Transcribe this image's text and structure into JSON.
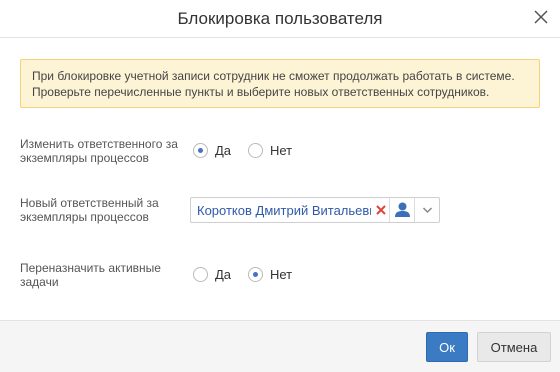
{
  "dialog": {
    "title": "Блокировка пользователя",
    "close_icon": "close-icon"
  },
  "warning": {
    "line1": "При блокировке учетной записи сотрудник не сможет продолжать работать в системе.",
    "line2": "Проверьте перечисленные пункты и выберите новых ответственных сотрудников."
  },
  "change_owner": {
    "label_line1": "Изменить ответственного за",
    "label_line2": "экземпляры процессов",
    "options": [
      {
        "label": "Да",
        "checked": true
      },
      {
        "label": "Нет",
        "checked": false
      }
    ]
  },
  "new_owner": {
    "label_line1": "Новый ответственный за",
    "label_line2": "экземпляры процессов",
    "value": "Коротков Дмитрий Витальевич (",
    "icons": [
      "clear-icon",
      "user-icon",
      "chevron-down-icon"
    ]
  },
  "reassign_tasks": {
    "label_line1": "Переназначить активные",
    "label_line2": "задачи",
    "options": [
      {
        "label": "Да",
        "checked": false
      },
      {
        "label": "Нет",
        "checked": true
      }
    ]
  },
  "footer": {
    "ok_label": "Ок",
    "cancel_label": "Отмена"
  },
  "colors": {
    "accent": "#3b7bc4",
    "warning_bg": "#fdf4d6",
    "warning_border": "#f4d27d",
    "link": "#2f5aa8",
    "clear_red": "#e0403a"
  }
}
